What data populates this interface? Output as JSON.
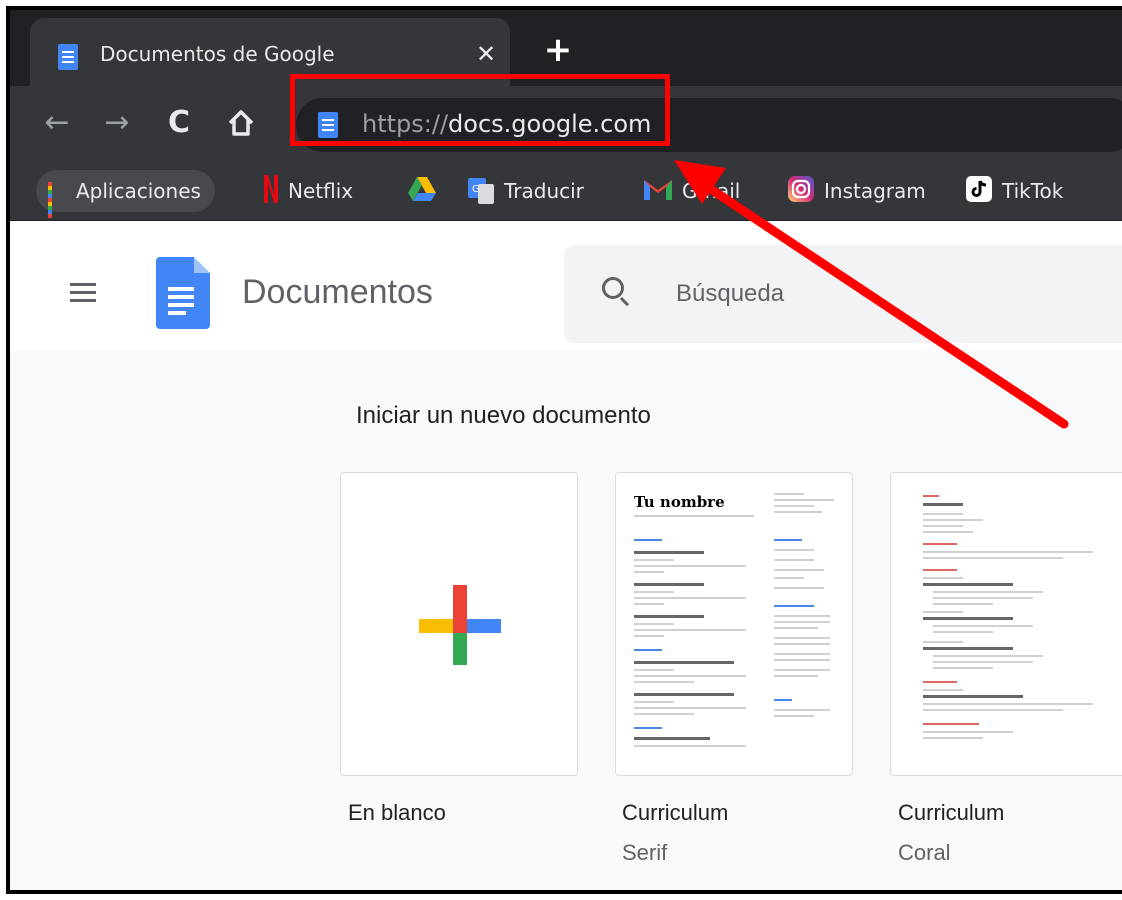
{
  "browser": {
    "tab_title": "Documentos de Google",
    "tab_close": "✕",
    "new_tab": "+",
    "url_scheme": "https://",
    "url_host": "docs.google.com"
  },
  "bookmarks": [
    {
      "label": "Aplicaciones",
      "icon": "apps-grid-icon"
    },
    {
      "label": "",
      "icon": "netflix-icon"
    },
    {
      "label": "Netflix",
      "icon": ""
    },
    {
      "label": "",
      "icon": "google-drive-icon"
    },
    {
      "label": "Traducir",
      "icon": "google-translate-icon"
    },
    {
      "label": "Gmail",
      "icon": "gmail-icon"
    },
    {
      "label": "Instagram",
      "icon": "instagram-icon"
    },
    {
      "label": "TikTok",
      "icon": "tiktok-icon"
    }
  ],
  "app": {
    "title": "Documentos",
    "search_placeholder": "Búsqueda"
  },
  "templates": {
    "heading": "Iniciar un nuevo documento",
    "items": [
      {
        "name": "En blanco",
        "sub": ""
      },
      {
        "name": "Curriculum",
        "sub": "Serif",
        "preview_title": "Tu nombre"
      },
      {
        "name": "Curriculum",
        "sub": "Coral"
      }
    ]
  },
  "colors": {
    "google_blue": "#4285f4",
    "google_red": "#ea4335",
    "google_yellow": "#fbbc04",
    "google_green": "#34a853",
    "annotation_red": "#ff0000"
  }
}
